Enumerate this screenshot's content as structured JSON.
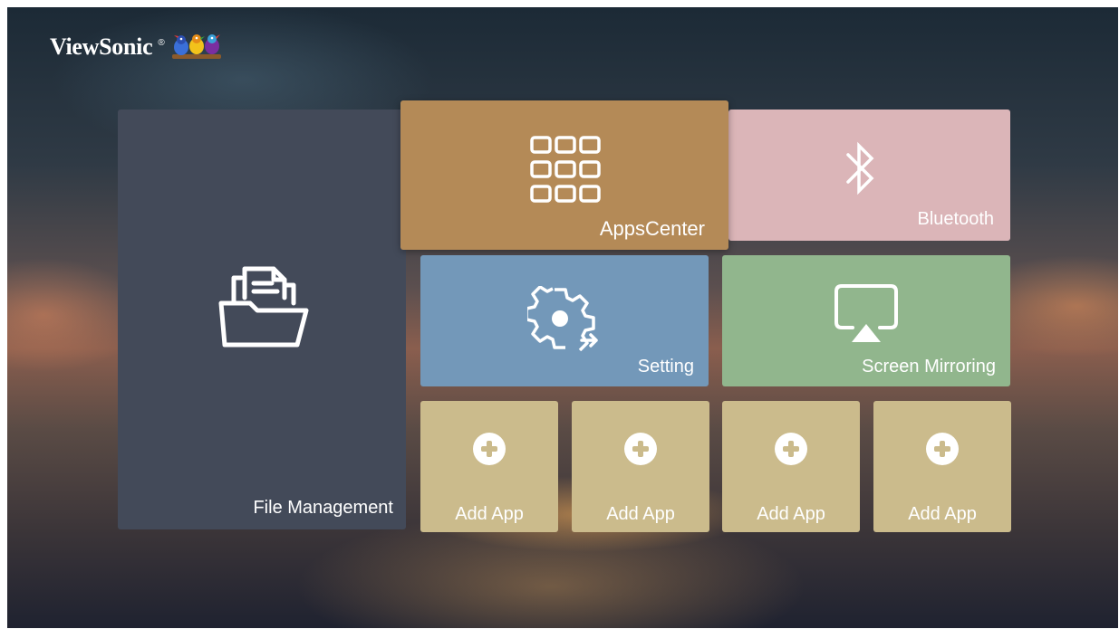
{
  "brand": {
    "name": "ViewSonic",
    "registered": "®",
    "logo_icon": "birds-logo-icon"
  },
  "tiles": {
    "file_management": {
      "label": "File Management",
      "icon": "folder-documents-icon",
      "color": "#434a59"
    },
    "apps_center": {
      "label": "AppsCenter",
      "icon": "app-grid-icon",
      "color": "#b48a57",
      "focused": true
    },
    "bluetooth": {
      "label": "Bluetooth",
      "icon": "bluetooth-icon",
      "color": "#dbb5b8"
    },
    "setting": {
      "label": "Setting",
      "icon": "gear-icon",
      "color": "#7398b9"
    },
    "screen_mirroring": {
      "label": "Screen Mirroring",
      "icon": "cast-screen-icon",
      "color": "#91b68d"
    },
    "add_apps": [
      {
        "label": "Add App",
        "icon": "plus-circle-icon"
      },
      {
        "label": "Add App",
        "icon": "plus-circle-icon"
      },
      {
        "label": "Add App",
        "icon": "plus-circle-icon"
      },
      {
        "label": "Add App",
        "icon": "plus-circle-icon"
      }
    ],
    "add_app_color": "#cbbb8c"
  }
}
